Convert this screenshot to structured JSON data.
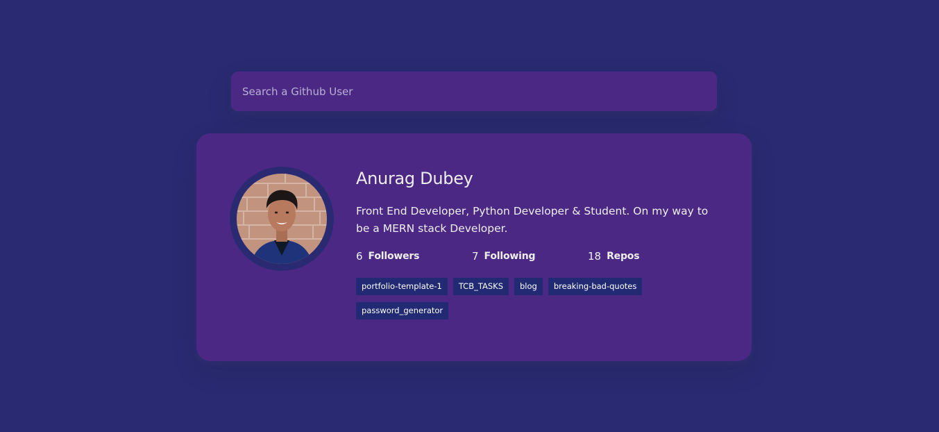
{
  "search": {
    "placeholder": "Search a Github User"
  },
  "profile": {
    "name": "Anurag Dubey",
    "bio": "Front End Developer, Python Developer & Student. On my way to be a MERN stack Developer.",
    "stats": {
      "followers": {
        "count": "6",
        "label": "Followers"
      },
      "following": {
        "count": "7",
        "label": "Following"
      },
      "repos": {
        "count": "18",
        "label": "Repos"
      }
    },
    "repos": [
      "portfolio-template-1",
      "TCB_TASKS",
      "blog",
      "breaking-bad-quotes",
      "password_generator"
    ]
  },
  "colors": {
    "background": "#2a2a72",
    "card": "#4c2885",
    "repo_tag": "#212a72",
    "text": "#eeeeee"
  }
}
